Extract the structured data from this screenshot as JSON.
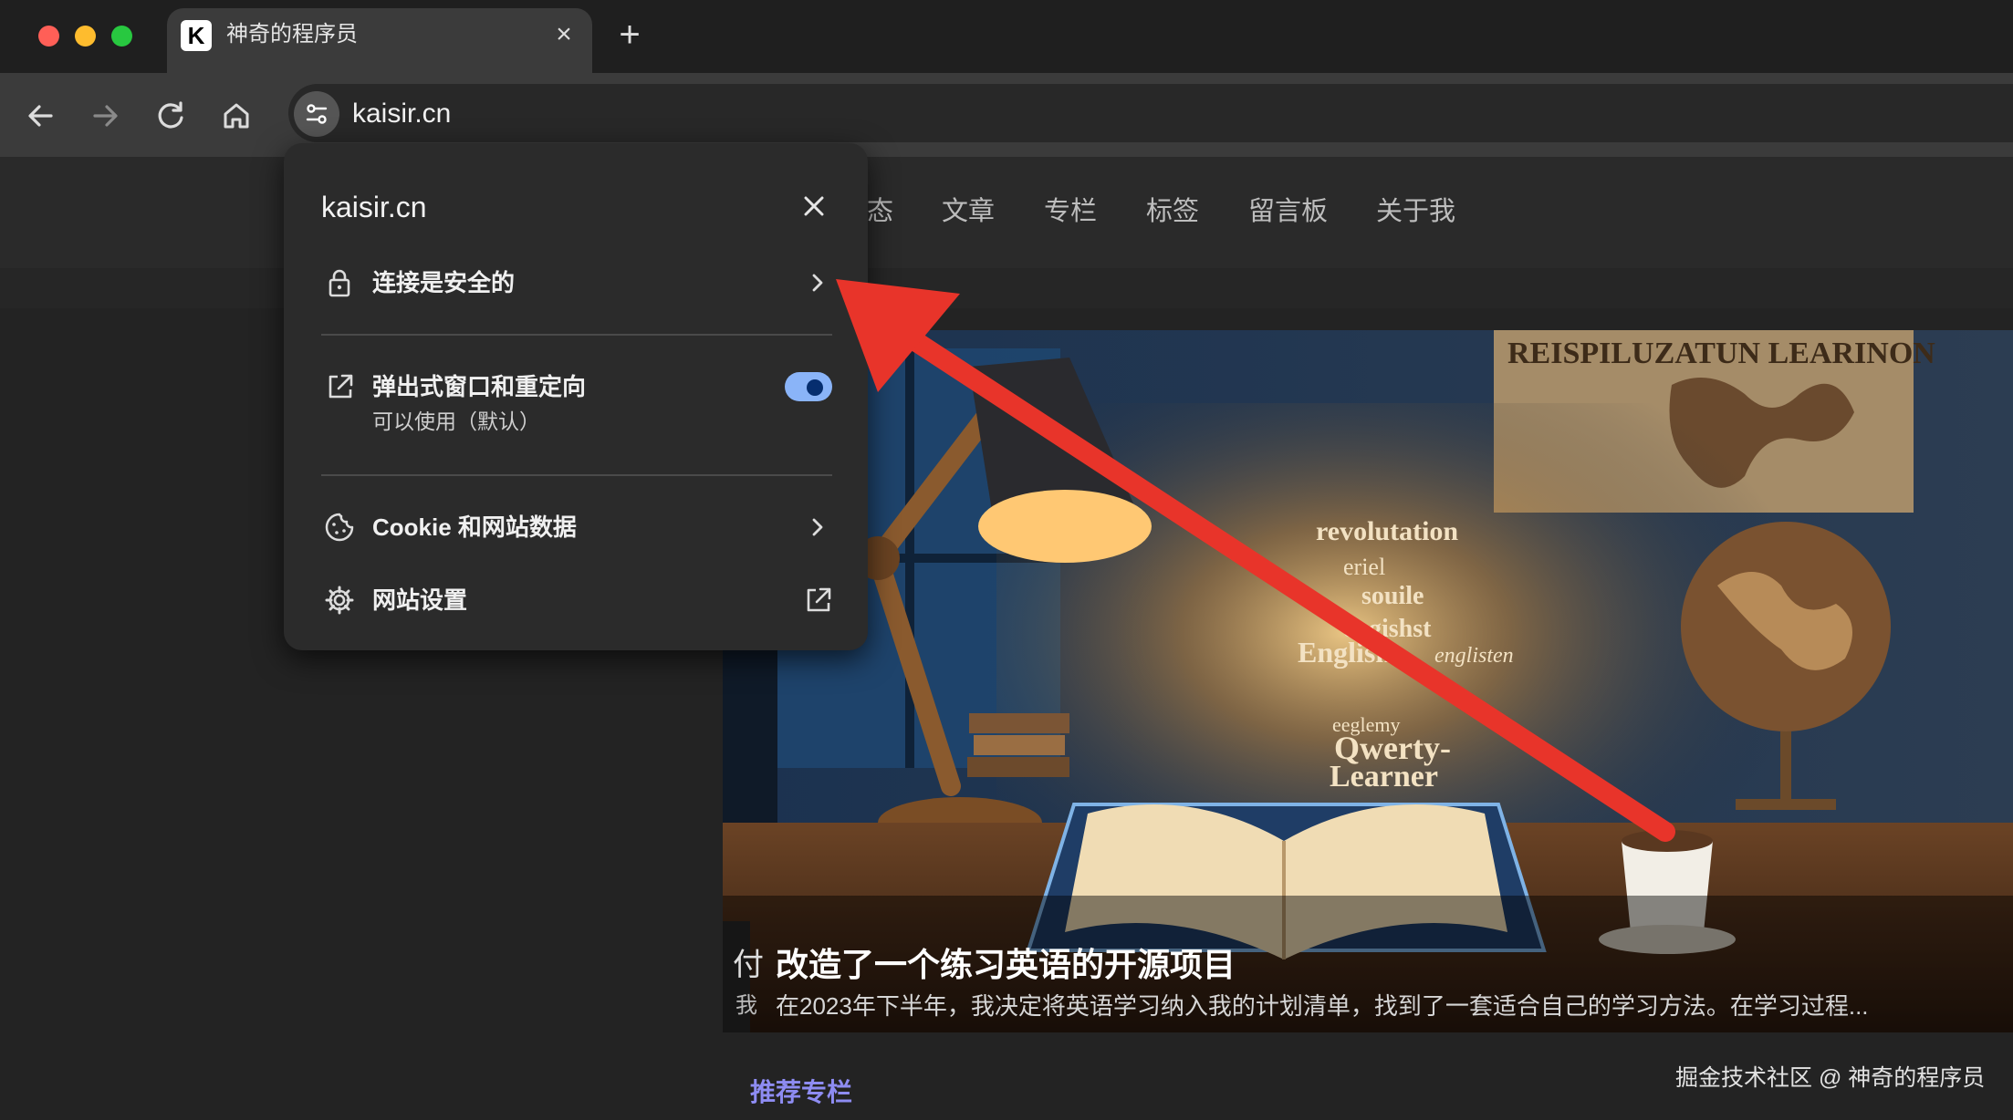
{
  "window": {
    "tab_title": "神奇的程序员",
    "tab_favicon": "K",
    "url": "kaisir.cn",
    "traffic_colors": [
      "#ff5f57",
      "#febc2e",
      "#28c840"
    ]
  },
  "site_nav": {
    "items": [
      "态",
      "文章",
      "专栏",
      "标签",
      "留言板",
      "关于我"
    ]
  },
  "popup": {
    "domain": "kaisir.cn",
    "connection": {
      "label": "连接是安全的",
      "icon": "lock-icon"
    },
    "popups": {
      "label": "弹出式窗口和重定向",
      "status": "可以使用（默认）",
      "enabled": true,
      "icon": "open-in-new-icon"
    },
    "cookies": {
      "label": "Cookie 和网站数据",
      "icon": "cookie-icon"
    },
    "site_settings": {
      "label": "网站设置",
      "icon": "gear-icon"
    }
  },
  "hero": {
    "title": "改造了一个练习英语的开源项目",
    "description": "在2023年下半年，我决定将英语学习纳入我的计划清单，找到了一套适合自己的学习方法。在学习过程...",
    "edge_title": "付",
    "edge_desc": "我",
    "image_words": {
      "poster": "REISPILUZATUN LEARINON",
      "cloud": [
        "revolutation",
        "eriel",
        "souile",
        "engishst",
        "English",
        "englisten",
        "Qwerty-",
        "Learner",
        "eeglemy"
      ]
    }
  },
  "recommend_label": "推荐专栏",
  "watermark": "掘金技术社区 @ 神奇的程序员",
  "colors": {
    "accent_toggle": "#8ab4f8",
    "annotation_arrow": "#e8342a",
    "recommend": "#8e8cf2"
  }
}
